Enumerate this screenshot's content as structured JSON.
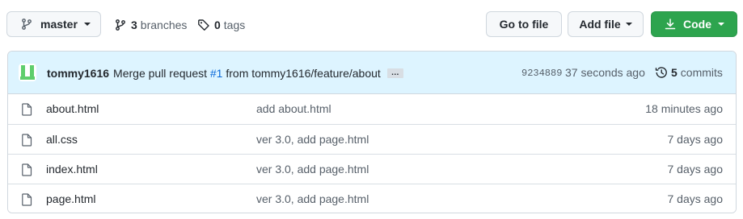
{
  "toolbar": {
    "branch_label": "master",
    "branches_count": "3",
    "branches_label": "branches",
    "tags_count": "0",
    "tags_label": "tags",
    "go_to_file_label": "Go to file",
    "add_file_label": "Add file",
    "code_label": "Code"
  },
  "latest_commit": {
    "author": "tommy1616",
    "message_prefix": "Merge pull request",
    "pr_number": "#1",
    "message_suffix": "from tommy1616/feature/about",
    "ellipsis": "…",
    "sha": "9234889",
    "time_ago": "37 seconds ago",
    "commits_count": "5",
    "commits_label": "commits"
  },
  "files": [
    {
      "name": "about.html",
      "message": "add about.html",
      "age": "18 minutes ago",
      "icon": "file-icon"
    },
    {
      "name": "all.css",
      "message": "ver 3.0, add page.html",
      "age": "7 days ago",
      "icon": "file-icon"
    },
    {
      "name": "index.html",
      "message": "ver 3.0, add page.html",
      "age": "7 days ago",
      "icon": "file-icon"
    },
    {
      "name": "page.html",
      "message": "ver 3.0, add page.html",
      "age": "7 days ago",
      "icon": "file-icon"
    }
  ],
  "colors": {
    "accent_green": "#2da44e",
    "link_blue": "#0969da",
    "header_bg": "#ddf4ff",
    "avatar_green": "#5fce6c"
  }
}
